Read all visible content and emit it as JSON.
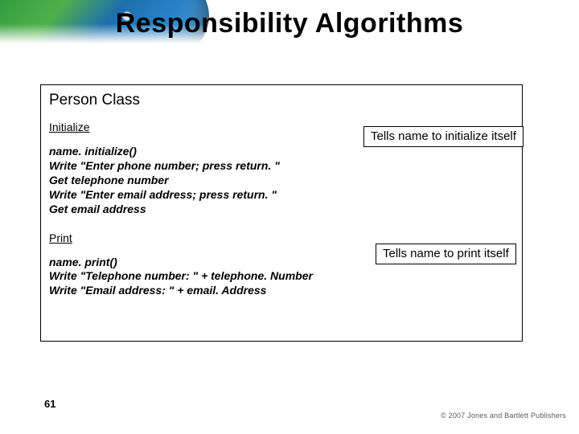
{
  "slide": {
    "title": "Responsibility Algorithms",
    "page_number": "61"
  },
  "content": {
    "class_title": "Person Class",
    "section_initialize": "Initialize",
    "code_initialize": "name. initialize()\nWrite \"Enter phone number; press return. \"\nGet telephone number\nWrite \"Enter email address; press return. \"\nGet email address",
    "section_print": "Print",
    "code_print": "name. print()\nWrite \"Telephone number: \" + telephone. Number\nWrite \"Email address: \" + email. Address"
  },
  "callouts": {
    "c1": "Tells name to initialize itself",
    "c2": "Tells name to print itself"
  },
  "footer": {
    "copyright": "© 2007 Jones and Bartlett Publishers"
  }
}
